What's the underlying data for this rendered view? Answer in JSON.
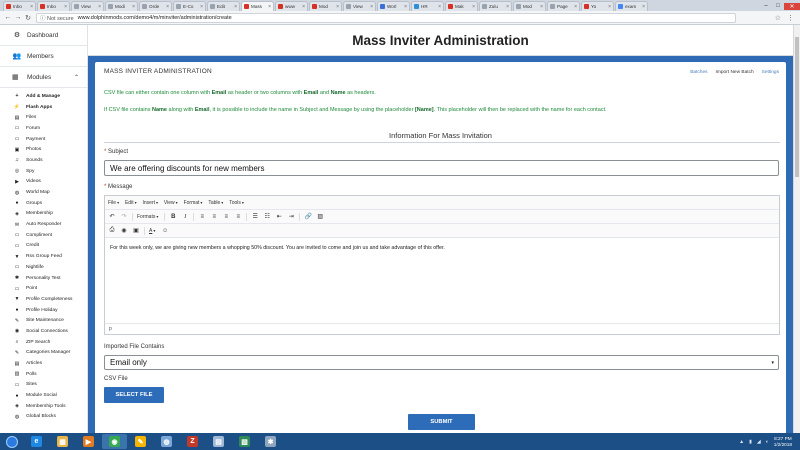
{
  "browser": {
    "tabs": [
      {
        "label": "Inbo",
        "color": "#d93025",
        "active": false
      },
      {
        "label": "Inbo",
        "color": "#d93025",
        "active": false
      },
      {
        "label": "View",
        "color": "#9aa3ad",
        "active": false
      },
      {
        "label": "Modi",
        "color": "#9aa3ad",
        "active": false
      },
      {
        "label": "Orde",
        "color": "#9aa3ad",
        "active": false
      },
      {
        "label": "E-Co",
        "color": "#9aa3ad",
        "active": false
      },
      {
        "label": "Edit",
        "color": "#9aa3ad",
        "active": false
      },
      {
        "label": "Mass",
        "color": "#d93025",
        "active": true
      },
      {
        "label": "www",
        "color": "#d93025",
        "active": false
      },
      {
        "label": "Mod",
        "color": "#d93025",
        "active": false
      },
      {
        "label": "View",
        "color": "#9aa3ad",
        "active": false
      },
      {
        "label": "Worl",
        "color": "#3b6fd8",
        "active": false
      },
      {
        "label": "HR",
        "color": "#2f8fd6",
        "active": false
      },
      {
        "label": "Mak",
        "color": "#d93025",
        "active": false
      },
      {
        "label": "Zulu",
        "color": "#9aa3ad",
        "active": false
      },
      {
        "label": "Mod",
        "color": "#9aa3ad",
        "active": false
      },
      {
        "label": "Page",
        "color": "#9aa3ad",
        "active": false
      },
      {
        "label": "Yo",
        "color": "#d93025",
        "active": false
      },
      {
        "label": "exam",
        "color": "#4285f4",
        "active": false
      }
    ],
    "tab_close": "×",
    "window_controls": {
      "minimize": "–",
      "maximize": "□",
      "close": "✕"
    },
    "back_icon": "←",
    "forward_icon": "→",
    "reload_icon": "↻",
    "security_label": "ⓘ Not secure",
    "url": "www.dolphinmods.com/demo4/m/minviter/administration/create",
    "star_icon": "☆",
    "menu_icon": "⋮"
  },
  "sidebar": {
    "nav": [
      {
        "label": "Dashboard",
        "icon": "⚙"
      },
      {
        "label": "Members",
        "icon": "👥"
      }
    ],
    "modules_label": "Modules",
    "modules_icon": "▦",
    "modules_chevron": "⌃",
    "items": [
      {
        "label": "Add & Manage",
        "icon": "+",
        "bold": true
      },
      {
        "label": "Flash Apps",
        "icon": "⚡",
        "bold": true
      },
      {
        "label": "Files",
        "icon": "▤",
        "bold": false
      },
      {
        "label": "Forum",
        "icon": "▭",
        "bold": false
      },
      {
        "label": "Payment",
        "icon": "▭",
        "bold": false
      },
      {
        "label": "Photos",
        "icon": "▣",
        "bold": false
      },
      {
        "label": "Sounds",
        "icon": "♫",
        "bold": false
      },
      {
        "label": "Spy",
        "icon": "◎",
        "bold": false
      },
      {
        "label": "Videos",
        "icon": "▶",
        "bold": false
      },
      {
        "label": "World Map",
        "icon": "◍",
        "bold": false
      },
      {
        "label": "Groups",
        "icon": "●",
        "bold": false
      },
      {
        "label": "Membership",
        "icon": "◈",
        "bold": false
      },
      {
        "label": "Auto Responder",
        "icon": "✉",
        "bold": false
      },
      {
        "label": "Compliment",
        "icon": "▭",
        "bold": false
      },
      {
        "label": "Credit",
        "icon": "▭",
        "bold": false
      },
      {
        "label": "Rss Group Feed",
        "icon": "▼",
        "bold": false
      },
      {
        "label": "Nightlife",
        "icon": "▭",
        "bold": false
      },
      {
        "label": "Personality Test",
        "icon": "✱",
        "bold": false
      },
      {
        "label": "Point",
        "icon": "▭",
        "bold": false
      },
      {
        "label": "Profile Completeness",
        "icon": "▼",
        "bold": false
      },
      {
        "label": "Profile Holiday",
        "icon": "●",
        "bold": false
      },
      {
        "label": "Site Maintenance",
        "icon": "✎",
        "bold": false
      },
      {
        "label": "Social Connections",
        "icon": "◉",
        "bold": false
      },
      {
        "label": "ZIP Search",
        "icon": "⌕",
        "bold": false
      },
      {
        "label": "Categories Manager",
        "icon": "✎",
        "bold": false
      },
      {
        "label": "Articles",
        "icon": "▤",
        "bold": false
      },
      {
        "label": "Polls",
        "icon": "▥",
        "bold": false
      },
      {
        "label": "Sites",
        "icon": "▭",
        "bold": false
      },
      {
        "label": "Module Social",
        "icon": "●",
        "bold": false
      },
      {
        "label": "Membership Tools",
        "icon": "◈",
        "bold": false
      },
      {
        "label": "Global Blocks",
        "icon": "◍",
        "bold": false
      }
    ]
  },
  "page": {
    "title": "Mass Inviter Administration",
    "panel_title": "MASS INVITER ADMINISTRATION",
    "links": [
      {
        "label": "Batches",
        "current": false
      },
      {
        "label": "Import New Batch",
        "current": true
      },
      {
        "label": "Settings",
        "current": false
      }
    ],
    "info1": {
      "a": "CSV file can either contain one column with ",
      "b": "Email",
      "c": " as header or two columns with ",
      "d": "Email",
      "e": " and ",
      "f": "Name",
      "g": " as headers."
    },
    "info2": {
      "a": "If CSV file contains ",
      "b": "Name",
      "c": " along with ",
      "d": "Email",
      "e": ", it is possible to include the name in Subject and Message by using the placeholder ",
      "f": "[Name]",
      "g": ". This placeholder will then be replaced with the name for each contact."
    },
    "section_title": "Information For Mass Invitation",
    "required_mark": "*",
    "subject_label": "Subject",
    "subject_value": "We are offering discounts for new members",
    "message_label": "Message",
    "editor": {
      "menus": [
        "File",
        "Edit",
        "Insert",
        "View",
        "Format",
        "Table",
        "Tools"
      ],
      "formats_label": "Formats",
      "caret": "▾",
      "icons": {
        "undo": "↶",
        "redo": "↷",
        "bold": "B",
        "italic": "I",
        "align_left": "≡",
        "align_center": "≡",
        "align_right": "≡",
        "justify": "≡",
        "bullets": "☰",
        "numbers": "☷",
        "outdent": "⇤",
        "indent": "⇥",
        "link": "🔗",
        "image": "▨",
        "print": "⎙",
        "preview": "◉",
        "media": "▣",
        "text_color": "A",
        "emoticon": "☺"
      },
      "body": "For this week only, we are giving new members a whopping 50% discount. You are invited to come and join us and take advantage of this offer.",
      "status": "p"
    },
    "imported_label": "Imported File Contains",
    "imported_value": "Email only",
    "select_arrow": "▾",
    "csv_label": "CSV File",
    "select_file_button": "SELECT FILE",
    "submit_button": "SUBMIT"
  },
  "taskbar": {
    "apps": [
      {
        "name": "ie",
        "glyph": "e",
        "color": "#1e88e5"
      },
      {
        "name": "explorer",
        "glyph": "▦",
        "color": "#e8b64a"
      },
      {
        "name": "media-player",
        "glyph": "▶",
        "color": "#e07b22"
      },
      {
        "name": "chrome",
        "glyph": "◉",
        "color": "#34a853"
      },
      {
        "name": "paint",
        "glyph": "✎",
        "color": "#f4b400"
      },
      {
        "name": "app",
        "glyph": "◍",
        "color": "#7aa7d8"
      },
      {
        "name": "filezilla",
        "glyph": "Z",
        "color": "#c0392b"
      },
      {
        "name": "notepad",
        "glyph": "▤",
        "color": "#9fb8d6"
      },
      {
        "name": "solitaire",
        "glyph": "▧",
        "color": "#2e8b57"
      },
      {
        "name": "tool",
        "glyph": "✱",
        "color": "#8fa5bd"
      }
    ],
    "tray_icons": [
      "▲",
      "▮",
      "◢",
      "◐"
    ],
    "time": "8:27 PM",
    "date": "1/2/2018"
  },
  "colors": {
    "accent": "#2d6cb8",
    "info_text": "#1f8a3a",
    "required": "#c0392b"
  }
}
